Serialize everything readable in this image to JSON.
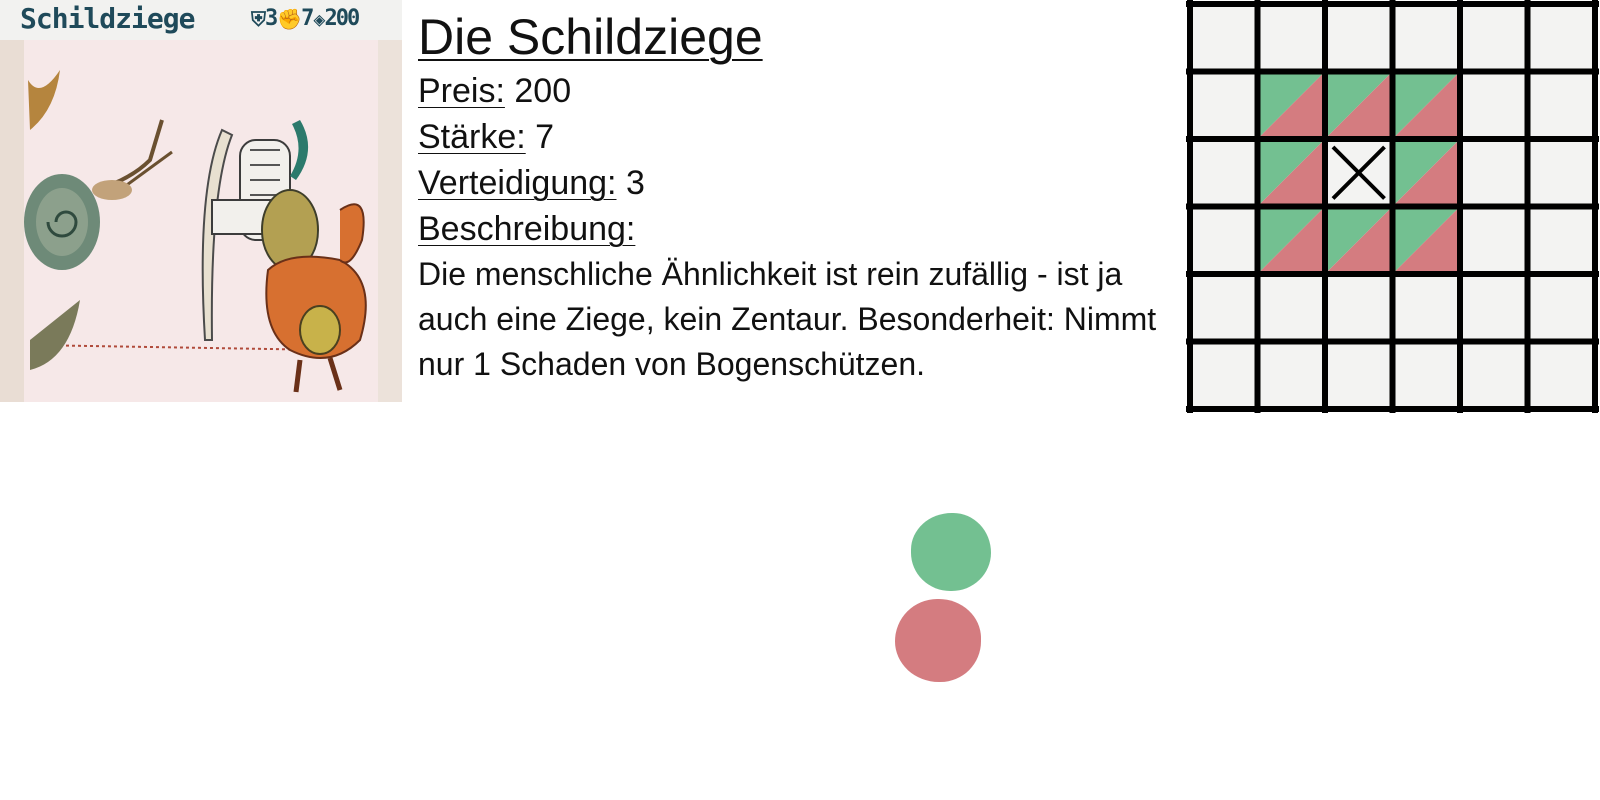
{
  "card": {
    "name": "Schildziege",
    "defense_value": "3",
    "strength_value": "7",
    "price_value": "200",
    "defense_icon": "shield-icon",
    "strength_icon": "fist-icon",
    "price_icon": "gem-icon"
  },
  "info": {
    "title": "Die Schildziege",
    "price_label": "Preis:",
    "price_value": "200",
    "strength_label": "Stärke:",
    "strength_value": "7",
    "defense_label": "Verteidigung:",
    "defense_value": "3",
    "description_label": "Beschreibung:",
    "description_text": "Die menschliche Ähnlichkeit ist rein zufällig - ist ja auch eine Ziege, kein Zentaur. Besonderheit: Nimmt nur 1 Schaden von Bogenschützen."
  },
  "grid": {
    "rows": 6,
    "cols": 6,
    "unit_cell": [
      2,
      2
    ],
    "attack_cells": [
      [
        1,
        1
      ],
      [
        1,
        2
      ],
      [
        1,
        3
      ],
      [
        2,
        1
      ],
      [
        2,
        3
      ],
      [
        3,
        1
      ],
      [
        3,
        2
      ],
      [
        3,
        3
      ]
    ],
    "cell_color": "#f3f3f2",
    "line_color": "#000000",
    "green_color": "#73c091",
    "red_color": "#d47c80"
  },
  "legend": {
    "green_color": "#73c091",
    "red_color": "#d47c80"
  }
}
